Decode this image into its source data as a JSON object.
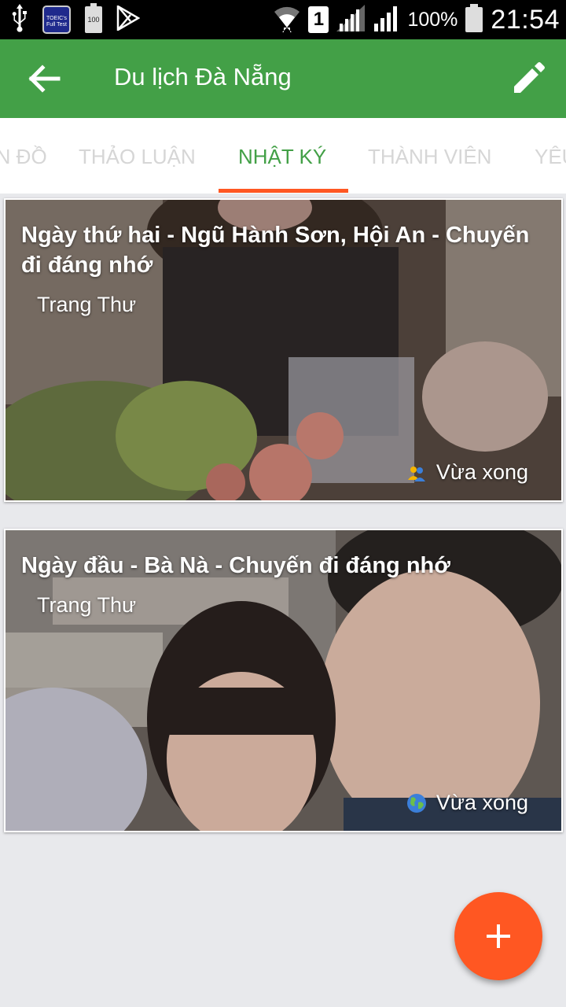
{
  "status_bar": {
    "battery_percent": "100%",
    "time": "21:54",
    "sim_label": "1",
    "toeic_label": "TOEIC's Full Test",
    "battery_app_label": "100",
    "icons": [
      "usb-icon",
      "toeic-app-icon",
      "battery-app-icon",
      "play-store-icon",
      "wifi-icon",
      "sim-icon",
      "signal-icon",
      "signal-icon-2",
      "battery-icon"
    ]
  },
  "app_bar": {
    "title": "Du lịch Đà Nẵng",
    "color": "#43a047"
  },
  "tabs": [
    {
      "label": "BẢN ĐỒ",
      "active": false
    },
    {
      "label": "THẢO LUẬN",
      "active": false
    },
    {
      "label": "NHẬT KÝ",
      "active": true
    },
    {
      "label": "THÀNH VIÊN",
      "active": false
    },
    {
      "label": "YÊU",
      "active": false
    }
  ],
  "accent_color": "#ff5722",
  "journal_entries": [
    {
      "title": "Ngày thứ hai - Ngũ Hành Sơn, Hội An - Chuyến đi đáng nhớ",
      "author": "Trang Thư",
      "status": "Vừa xong",
      "status_icon": "friends-icon"
    },
    {
      "title": "Ngày đầu - Bà Nà - Chuyến đi đáng nhớ",
      "author": "Trang Thư",
      "status": "Vừa xong",
      "status_icon": "globe-icon"
    }
  ],
  "fab": {
    "icon": "plus-icon"
  }
}
